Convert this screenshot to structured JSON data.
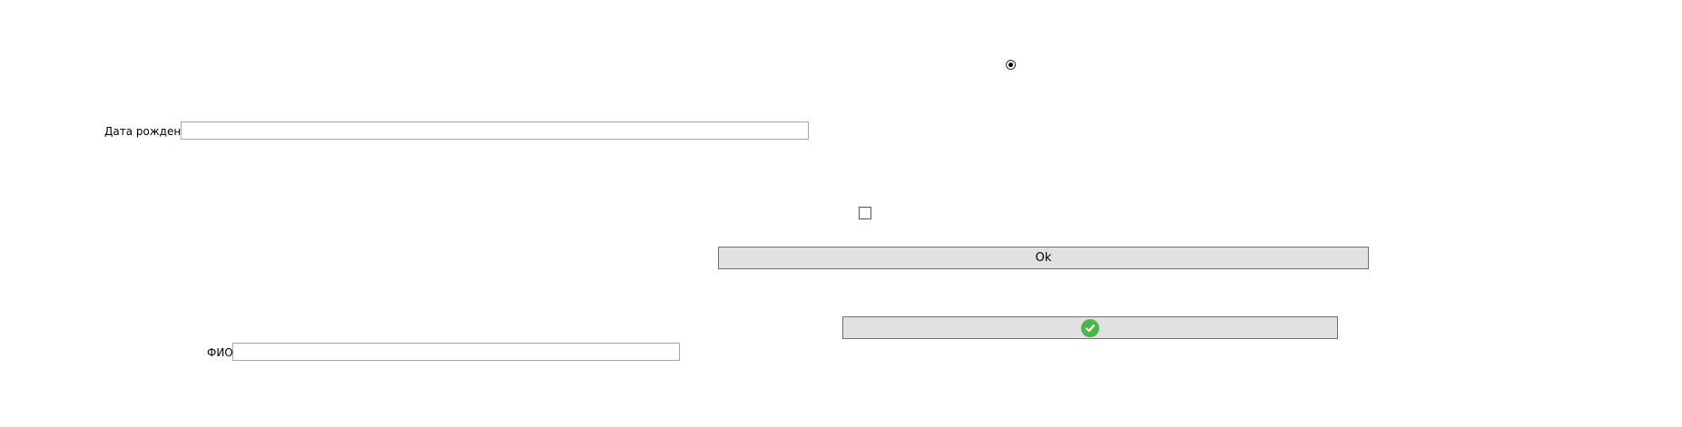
{
  "form": {
    "radio": {
      "checked": true
    },
    "birth_date": {
      "label": "Дата рождения",
      "value": ""
    },
    "checkbox": {
      "checked": false
    },
    "ok_button": {
      "label": "Ok"
    },
    "confirm_button": {
      "icon": "check-circle-icon",
      "icon_color": "#4cb749"
    },
    "fio": {
      "label": "ФИО",
      "value": ""
    }
  }
}
